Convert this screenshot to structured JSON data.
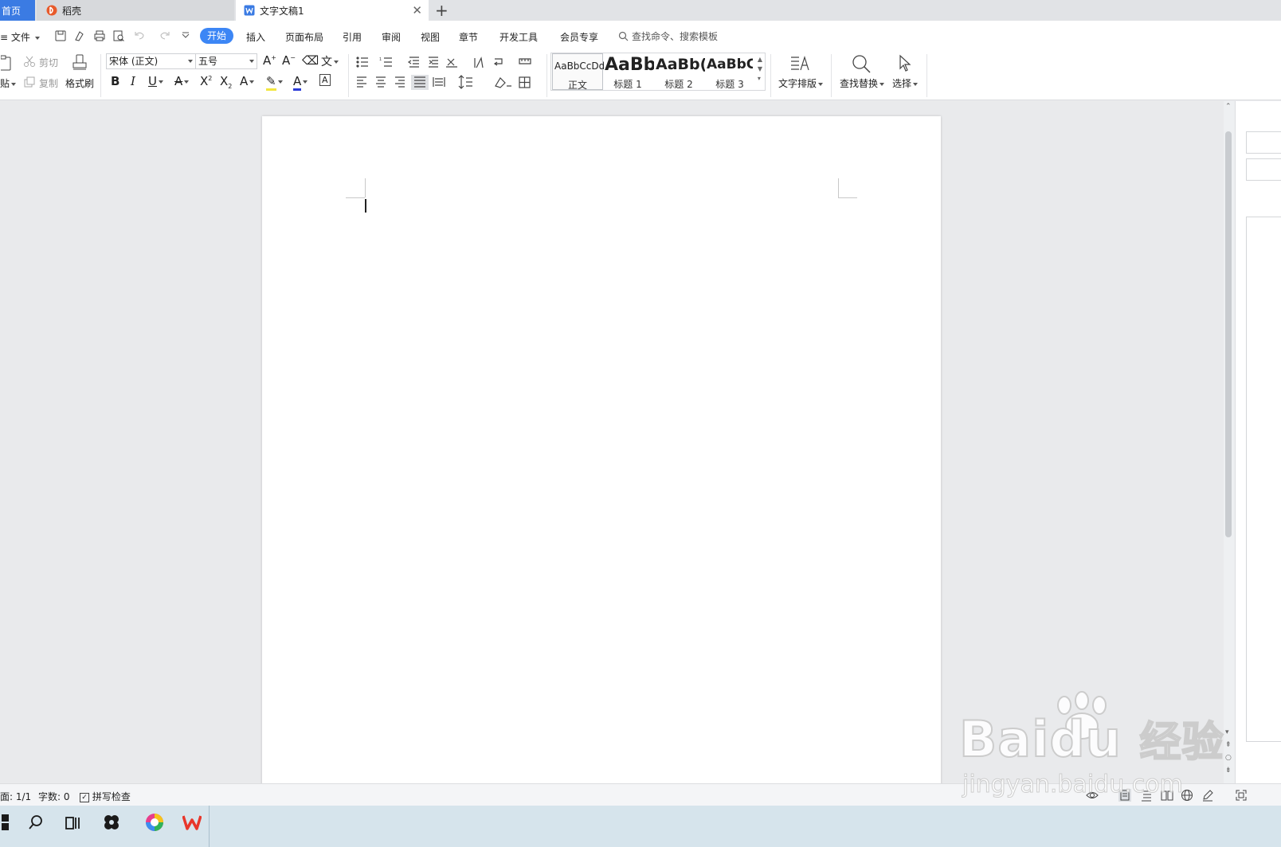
{
  "tabs": [
    {
      "label": "首页",
      "active": false
    },
    {
      "label": "稻壳",
      "active": false
    },
    {
      "label": "文字文稿1",
      "active": true
    }
  ],
  "menu": {
    "file": "文件",
    "items": [
      "开始",
      "插入",
      "页面布局",
      "引用",
      "审阅",
      "视图",
      "章节",
      "开发工具",
      "会员专享"
    ],
    "active": "开始",
    "search_placeholder": "查找命令、搜索模板"
  },
  "clipboard": {
    "paste": "贴",
    "cut": "剪切",
    "copy": "复制",
    "format_painter": "格式刷"
  },
  "font": {
    "family": "宋体 (正文)",
    "size": "五号"
  },
  "styles": [
    {
      "preview": "AaBbCcDd",
      "name": "正文"
    },
    {
      "preview": "AaBb",
      "name": "标题 1"
    },
    {
      "preview": "AaBb(",
      "name": "标题 2"
    },
    {
      "preview": "AaBbC(",
      "name": "标题 3"
    }
  ],
  "tools": {
    "text_layout": "文字排版",
    "find_replace": "查找替换",
    "select": "选择"
  },
  "status": {
    "page": "面: 1/1",
    "words": "字数: 0",
    "spellcheck": "拼写检查"
  },
  "watermark": {
    "brand": "Bai",
    "brand2": "du",
    "cn": "经验",
    "url": "jingyan.baidu.com"
  },
  "colors": {
    "accent": "#3c86f5",
    "home_tab": "#3b7be3",
    "font_color": "#2b3bd8",
    "highlight": "#f2e640"
  },
  "icons": [
    "save-icon",
    "undo-icon",
    "redo-icon",
    "print-icon",
    "preview-icon",
    "search-icon",
    "select-cursor-icon"
  ]
}
